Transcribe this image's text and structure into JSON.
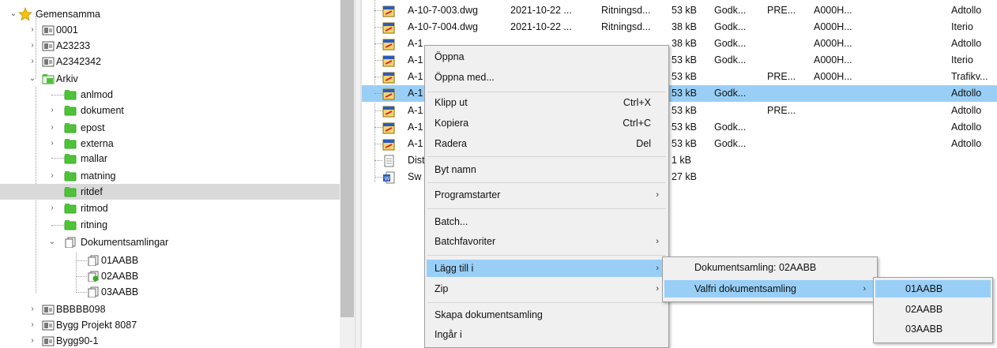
{
  "tree": {
    "root_label": "Gemensamma",
    "items": [
      {
        "label": "0001"
      },
      {
        "label": "A23233"
      },
      {
        "label": "A2342342"
      },
      {
        "label": "Arkiv"
      },
      {
        "label": "anlmod"
      },
      {
        "label": "dokument"
      },
      {
        "label": "epost"
      },
      {
        "label": "externa"
      },
      {
        "label": "mallar"
      },
      {
        "label": "matning"
      },
      {
        "label": "ritdef"
      },
      {
        "label": "ritmod"
      },
      {
        "label": "ritning"
      },
      {
        "label": "Dokumentsamlingar"
      },
      {
        "label": "01AABB"
      },
      {
        "label": "02AABB"
      },
      {
        "label": "03AABB"
      },
      {
        "label": "BBBBB098"
      },
      {
        "label": "Bygg Projekt 8087"
      },
      {
        "label": "Bygg90-1"
      }
    ]
  },
  "files": [
    {
      "name": "A-10-7-003.dwg",
      "date": "2021-10-22 ...",
      "type": "Ritningsd...",
      "size": "53 kB",
      "status": "Godk...",
      "c6": "PRE...",
      "c7": "A000H...",
      "owner": "Adtollo"
    },
    {
      "name": "A-10-7-004.dwg",
      "date": "2021-10-22 ...",
      "type": "Ritningsd...",
      "size": "38 kB",
      "status": "Godk...",
      "c6": "",
      "c7": "A000H...",
      "owner": "Iterio"
    },
    {
      "name": "A-1",
      "date": "",
      "type": "",
      "size": "38 kB",
      "status": "Godk...",
      "c6": "",
      "c7": "A000H...",
      "owner": "Adtollo"
    },
    {
      "name": "A-1",
      "date": "",
      "type": "",
      "size": "53 kB",
      "status": "Godk...",
      "c6": "",
      "c7": "A000H...",
      "owner": "Iterio"
    },
    {
      "name": "A-1",
      "date": "",
      "type": "",
      "size": "53 kB",
      "status": "",
      "c6": "PRE...",
      "c7": "A000H...",
      "owner": "Trafikv..."
    },
    {
      "name": "A-1",
      "date": "",
      "type": "",
      "size": "53 kB",
      "status": "Godk...",
      "c6": "",
      "c7": "",
      "owner": "Adtollo"
    },
    {
      "name": "A-1",
      "date": "",
      "type": "",
      "size": "53 kB",
      "status": "",
      "c6": "PRE...",
      "c7": "",
      "owner": "Adtollo"
    },
    {
      "name": "A-1",
      "date": "",
      "type": "",
      "size": "53 kB",
      "status": "Godk...",
      "c6": "",
      "c7": "",
      "owner": "Adtollo"
    },
    {
      "name": "A-1",
      "date": "",
      "type": "",
      "size": "53 kB",
      "status": "Godk...",
      "c6": "",
      "c7": "",
      "owner": "Adtollo"
    },
    {
      "name": "Dist",
      "date": "",
      "type": "",
      "size": "1 kB",
      "status": "",
      "c6": "",
      "c7": "",
      "owner": ""
    },
    {
      "name": "Sw",
      "date": "",
      "type": "",
      "size": "27 kB",
      "status": "",
      "c6": "",
      "c7": "",
      "owner": ""
    }
  ],
  "context_menu": {
    "items": [
      {
        "label": "Öppna",
        "shortcut": ""
      },
      {
        "label": "Öppna med...",
        "shortcut": ""
      },
      {
        "label": "Klipp ut",
        "shortcut": "Ctrl+X"
      },
      {
        "label": "Kopiera",
        "shortcut": "Ctrl+C"
      },
      {
        "label": "Radera",
        "shortcut": "Del"
      },
      {
        "label": "Byt namn",
        "shortcut": ""
      },
      {
        "label": "Programstarter",
        "shortcut": ""
      },
      {
        "label": "Batch...",
        "shortcut": ""
      },
      {
        "label": "Batchfavoriter",
        "shortcut": ""
      },
      {
        "label": "Lägg till i",
        "shortcut": ""
      },
      {
        "label": "Zip",
        "shortcut": ""
      },
      {
        "label": "Skapa dokumentsamling",
        "shortcut": ""
      },
      {
        "label": "Ingår i",
        "shortcut": ""
      }
    ]
  },
  "submenu_add_to": {
    "items": [
      {
        "label": "Dokumentsamling: 02AABB"
      },
      {
        "label": "Valfri dokumentsamling"
      }
    ]
  },
  "submenu_collections": {
    "items": [
      {
        "label": "01AABB"
      },
      {
        "label": "02AABB"
      },
      {
        "label": "03AABB"
      }
    ]
  },
  "colors": {
    "selection": "#99cff7",
    "tree_selection": "#d9d9d9",
    "folder_green": "#4fc23a",
    "star": "#f4c20d"
  }
}
